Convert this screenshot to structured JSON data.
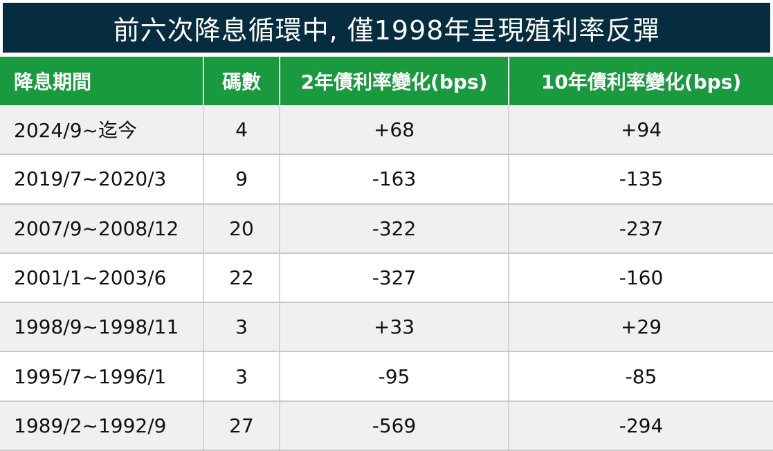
{
  "title": "前六次降息循環中, 僅1998年呈現殖利率反彈",
  "colors": {
    "title_bg": "#062c40",
    "header_bg": "#1a9a3e",
    "positive_text": "#e8141c",
    "stripe": "#f0f0f0"
  },
  "table": {
    "headers": [
      "降息期間",
      "碼數",
      "2年債利率變化(bps)",
      "10年債利率變化(bps)"
    ],
    "rows": [
      {
        "period": "2024/9~迄今",
        "cuts": "4",
        "y2": "+68",
        "y10": "+94"
      },
      {
        "period": "2019/7~2020/3",
        "cuts": "9",
        "y2": "-163",
        "y10": "-135"
      },
      {
        "period": "2007/9~2008/12",
        "cuts": "20",
        "y2": "-322",
        "y10": "-237"
      },
      {
        "period": "2001/1~2003/6",
        "cuts": "22",
        "y2": "-327",
        "y10": "-160"
      },
      {
        "period": "1998/9~1998/11",
        "cuts": "3",
        "y2": "+33",
        "y10": "+29"
      },
      {
        "period": "1995/7~1996/1",
        "cuts": "3",
        "y2": "-95",
        "y10": "-85"
      },
      {
        "period": "1989/2~1992/9",
        "cuts": "27",
        "y2": "-569",
        "y10": "-294"
      }
    ]
  }
}
